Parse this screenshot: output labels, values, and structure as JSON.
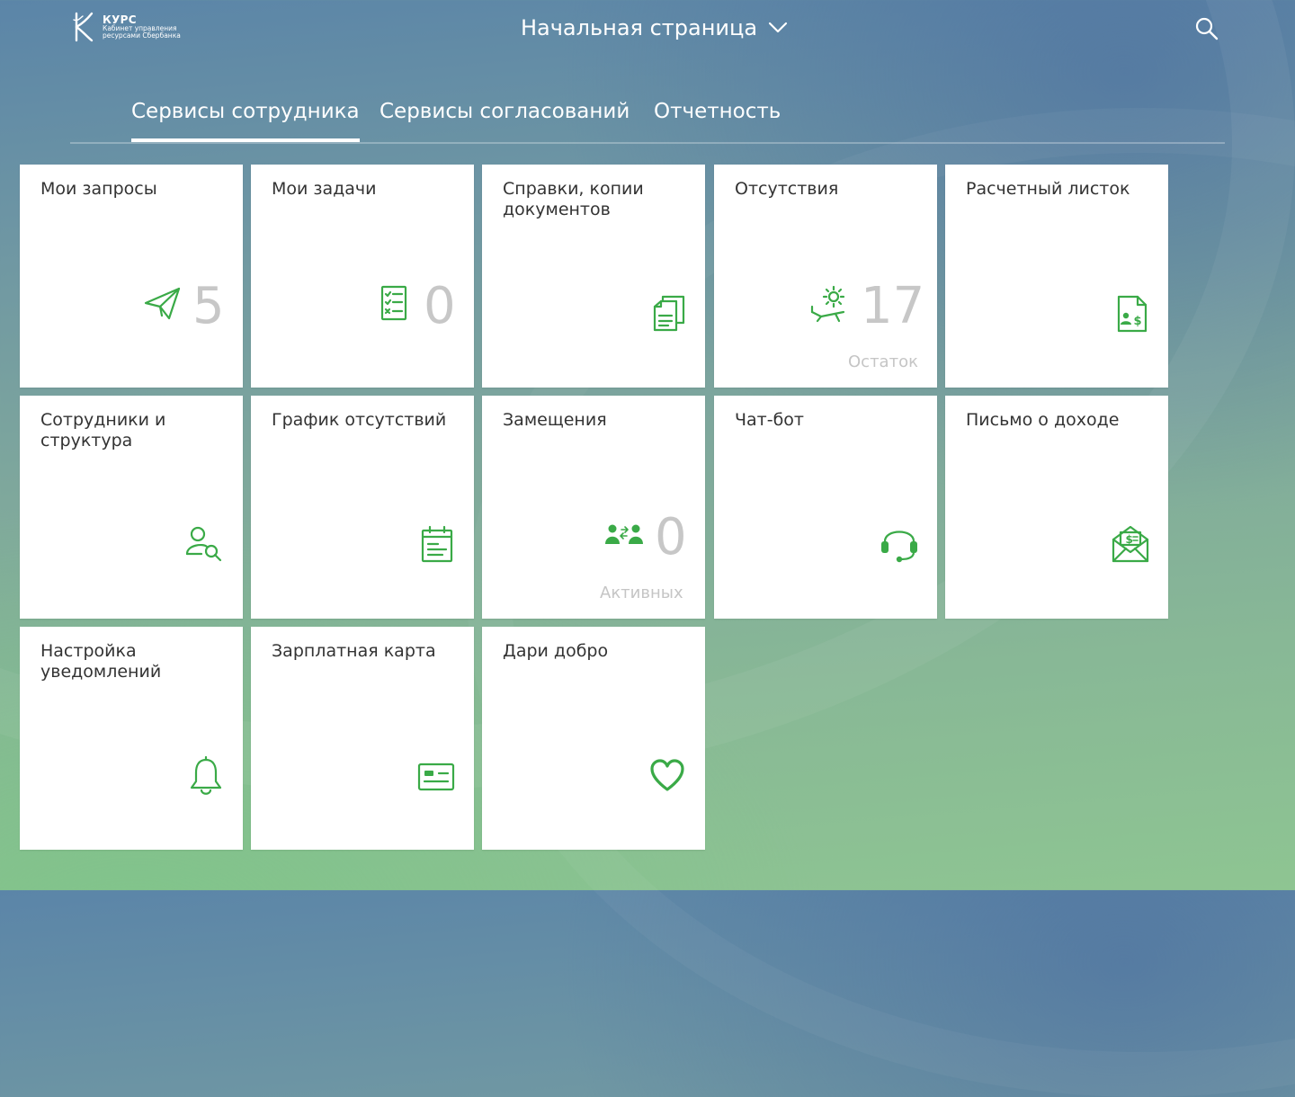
{
  "header": {
    "logo_name": "КУРС",
    "logo_sub_1": "Кабинет управления",
    "logo_sub_2": "ресурсами Сбербанка",
    "title": "Начальная страница"
  },
  "tabs": [
    {
      "label": "Сервисы сотрудника",
      "active": true
    },
    {
      "label": "Сервисы согласований",
      "active": false
    },
    {
      "label": "Отчетность",
      "active": false
    }
  ],
  "tiles": [
    {
      "title": "Мои запросы",
      "icon": "paper-plane-icon",
      "count": "5"
    },
    {
      "title": "Мои задачи",
      "icon": "checklist-icon",
      "count": "0"
    },
    {
      "title": "Справки, копии документов",
      "icon": "documents-icon"
    },
    {
      "title": "Отсутствия",
      "icon": "sun-lounger-icon",
      "count": "17",
      "sub": "Остаток"
    },
    {
      "title": "Расчетный листок",
      "icon": "payslip-icon"
    },
    {
      "title": "Сотрудники и структура",
      "icon": "person-search-icon"
    },
    {
      "title": "График отсутствий",
      "icon": "calendar-icon"
    },
    {
      "title": "Замещения",
      "icon": "people-swap-icon",
      "count": "0",
      "sub": "Активных"
    },
    {
      "title": "Чат-бот",
      "icon": "headset-icon"
    },
    {
      "title": "Письмо о доходе",
      "icon": "income-letter-icon"
    },
    {
      "title": "Настройка уведомлений",
      "icon": "bell-icon"
    },
    {
      "title": "Зарплатная карта",
      "icon": "card-icon"
    },
    {
      "title": "Дари добро",
      "icon": "heart-icon"
    }
  ],
  "colors": {
    "accent": "#3aaa47",
    "tile_bg": "#ffffff",
    "count_gray": "#c7c7c7"
  }
}
